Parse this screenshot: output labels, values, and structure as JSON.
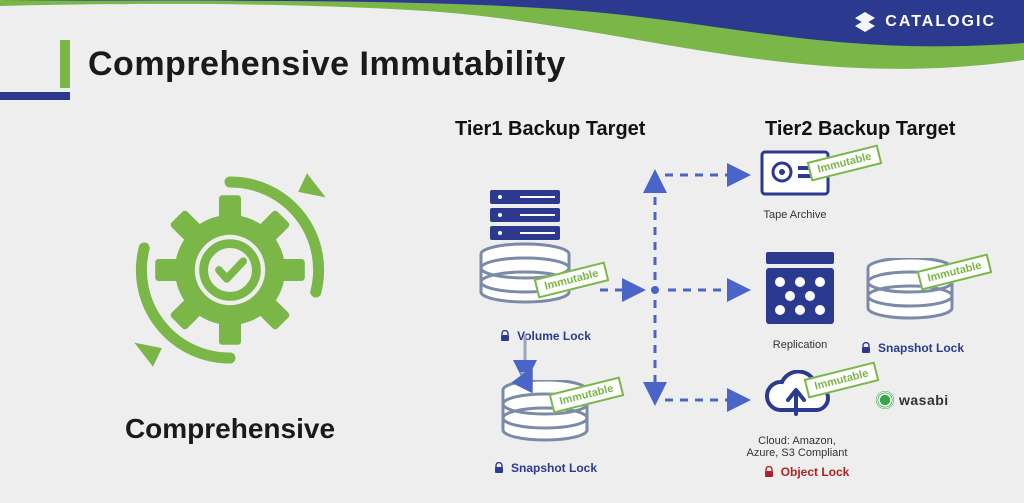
{
  "brand": {
    "name": "CATALOGIC"
  },
  "title": "Comprehensive Immutability",
  "left": {
    "label": "Comprehensive"
  },
  "tier1": {
    "heading": "Tier1 Backup Target",
    "volumeLock": "Volume Lock",
    "snapshotLock": "Snapshot Lock",
    "badge1": "Immutable",
    "badge2": "Immutable"
  },
  "tier2": {
    "heading": "Tier2 Backup Target",
    "tape": {
      "label": "Tape Archive",
      "badge": "Immutable"
    },
    "replication": {
      "label": "Replication",
      "badge": "Immutable",
      "lock": "Snapshot Lock"
    },
    "cloud": {
      "label": "Cloud: Amazon, Azure, S3 Compliant",
      "badge": "Immutable",
      "lock": "Object Lock",
      "partner": "wasabi"
    }
  },
  "colors": {
    "green": "#7ab648",
    "navy": "#2b3a8f",
    "slate": "#7b8aa6",
    "red": "#b22222"
  }
}
